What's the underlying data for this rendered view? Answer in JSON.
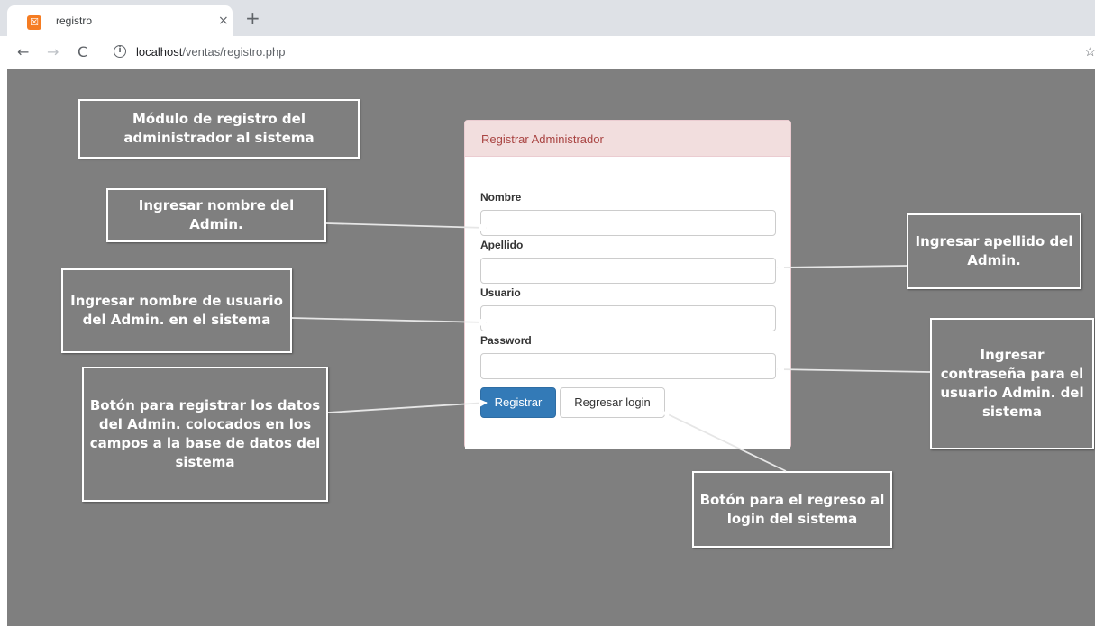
{
  "browser": {
    "tab_title": "registro",
    "tab_favicon": "xampp-icon",
    "tab_close": "×",
    "new_tab": "+",
    "url_host": "localhost",
    "url_path": "/ventas/registro.php",
    "icons": {
      "back": "←",
      "forward": "→",
      "reload": "C",
      "info": "i",
      "star": "☆"
    }
  },
  "panel": {
    "title": "Registrar Administrador",
    "fields": [
      {
        "label": "Nombre",
        "value": ""
      },
      {
        "label": "Apellido",
        "value": ""
      },
      {
        "label": "Usuario",
        "value": ""
      },
      {
        "label": "Password",
        "value": ""
      }
    ],
    "register_button": "Registrar",
    "back_button": "Regresar login"
  },
  "callouts": {
    "module": "Módulo de registro del administrador al sistema",
    "nombre": "Ingresar nombre del Admin.",
    "apellido": "Ingresar apellido del Admin.",
    "usuario": "Ingresar nombre de usuario del Admin. en el sistema",
    "password": "Ingresar contraseña para el usuario Admin. del sistema",
    "registrar": "Botón para registrar los datos del Admin. colocados en los campos a la base de datos del sistema",
    "regresar": "Botón para el regreso al login del sistema"
  },
  "colors": {
    "background": "#7f7f7f",
    "panel_heading": "#f2dede",
    "panel_title": "#a94442",
    "primary_button": "#337ab7"
  }
}
